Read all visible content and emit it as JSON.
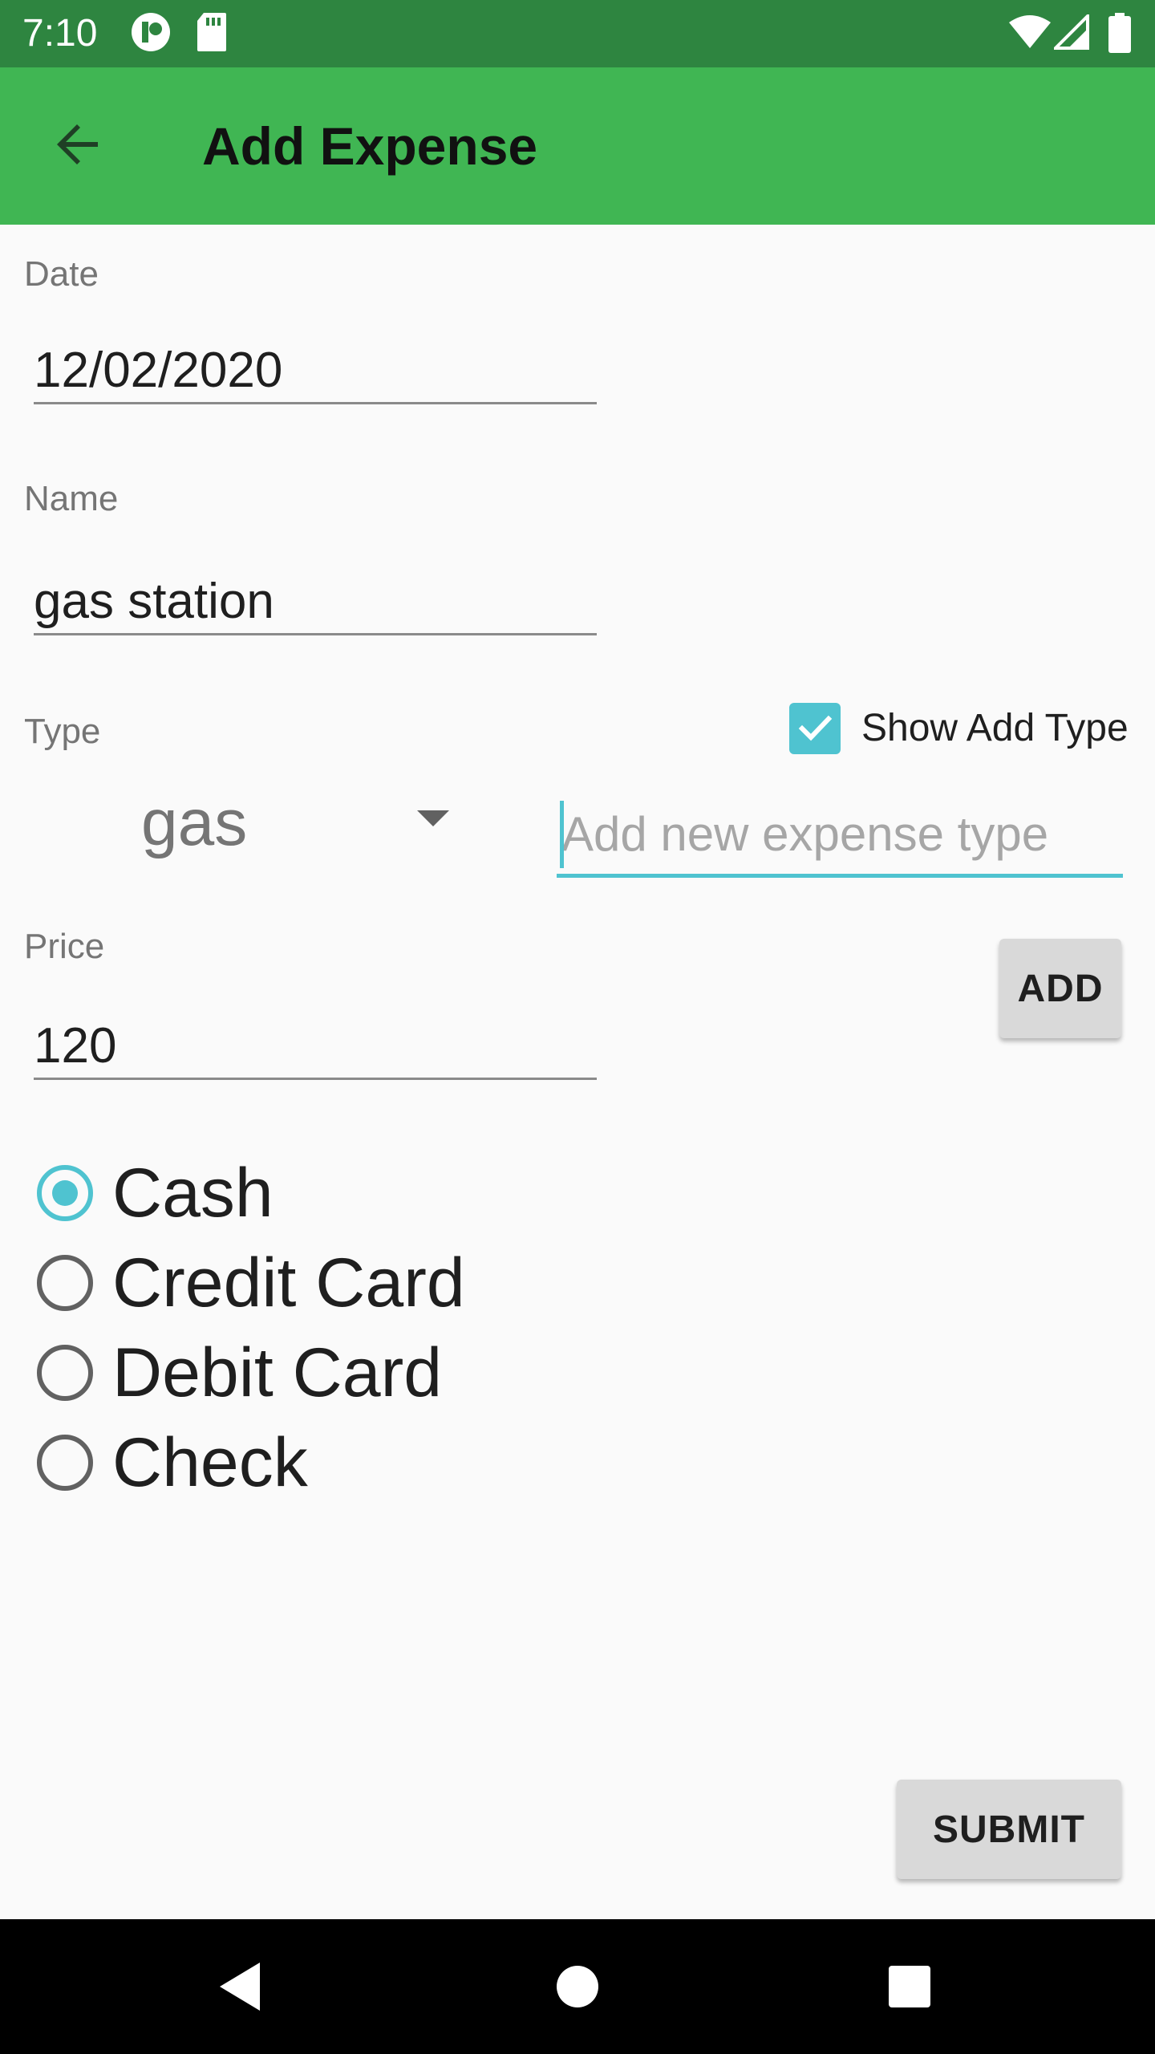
{
  "status_bar": {
    "time": "7:10",
    "icons": [
      "app-notification-icon",
      "sd-card-icon",
      "wifi-icon",
      "cell-signal-icon",
      "battery-icon"
    ]
  },
  "app_bar": {
    "title": "Add Expense",
    "back_icon": "arrow-back-icon",
    "color": "#40b653"
  },
  "form": {
    "date": {
      "label": "Date",
      "value": "12/02/2020"
    },
    "name": {
      "label": "Name",
      "value": "gas station"
    },
    "type": {
      "label": "Type",
      "selected": "gas",
      "show_add_type_label": "Show Add Type",
      "show_add_type_checked": true,
      "new_type_placeholder": "Add new expense type",
      "add_button_label": "ADD"
    },
    "price": {
      "label": "Price",
      "value": "120"
    },
    "payment_methods": [
      {
        "label": "Cash",
        "checked": true
      },
      {
        "label": "Credit Card",
        "checked": false
      },
      {
        "label": "Debit Card",
        "checked": false
      },
      {
        "label": "Check",
        "checked": false
      }
    ],
    "submit_label": "SUBMIT"
  },
  "colors": {
    "accent": "#4fc3d0",
    "status_bar": "#2e8540"
  }
}
